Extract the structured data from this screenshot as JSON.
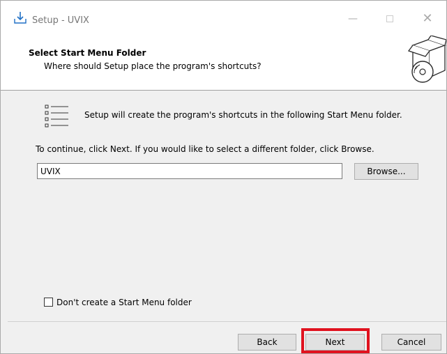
{
  "window": {
    "title": "Setup - UVIX",
    "icons": {
      "app": "installer-download-icon",
      "minimize": "minimize-icon",
      "maximize": "maximize-icon",
      "close": "close-icon"
    }
  },
  "header": {
    "title": "Select Start Menu Folder",
    "subtitle": "Where should Setup place the program's shortcuts?",
    "icon": "software-box-disc-icon"
  },
  "body": {
    "icon": "list-icon",
    "shortcut_text": "Setup will create the program's shortcuts in the following Start Menu folder.",
    "continue_text": "To continue, click Next. If you would like to select a different folder, click Browse.",
    "folder_value": "UVIX",
    "browse_label": "Browse...",
    "checkbox_label": "Don't create a Start Menu folder",
    "checkbox_checked": false
  },
  "footer": {
    "back_label": "Back",
    "next_label": "Next",
    "cancel_label": "Cancel"
  },
  "colors": {
    "highlight": "#e0121f",
    "background": "#f0f0f0",
    "header_bg": "#ffffff"
  }
}
